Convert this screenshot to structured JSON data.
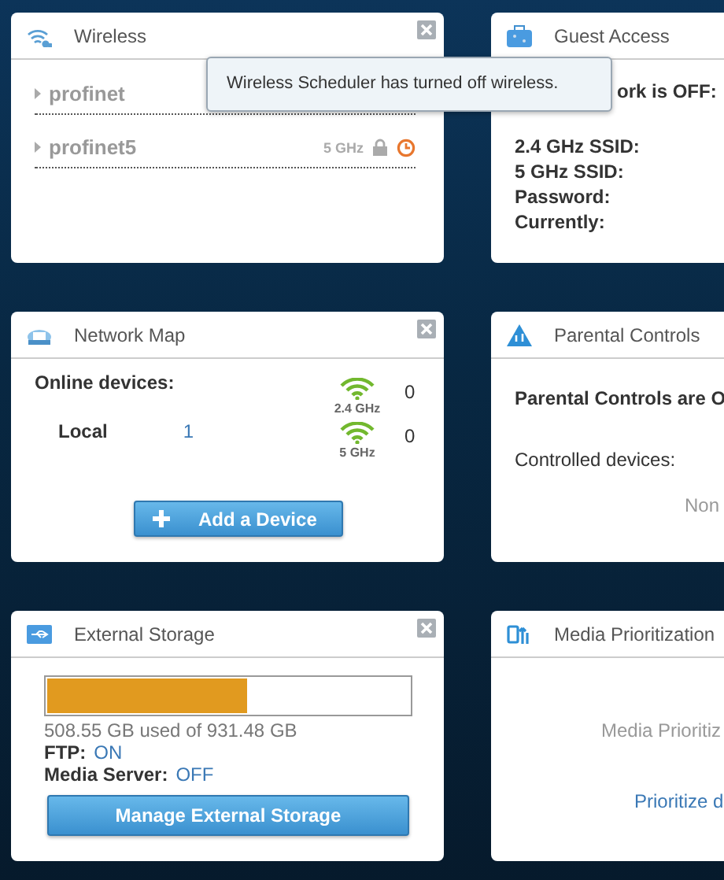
{
  "cards": [
    {
      "kind": "wireless",
      "title": "Wireless",
      "closable": true,
      "networks": [
        {
          "name": "profinet"
        },
        {
          "name": "profinet5",
          "band": "5 GHz",
          "locked": true,
          "scheduled": true
        }
      ],
      "tooltip": "Wireless Scheduler has turned off wireless."
    },
    {
      "kind": "guest",
      "title": "Guest Access",
      "status": "ork is OFF:",
      "fields": [
        "2.4 GHz SSID:",
        "5 GHz SSID:",
        "Password:",
        "Currently:"
      ]
    },
    {
      "kind": "network_map",
      "title": "Network Map",
      "closable": true,
      "heading": "Online devices:",
      "local_label": "Local",
      "local_count": "1",
      "bands": [
        {
          "label": "2.4 GHz",
          "count": "0"
        },
        {
          "label": "5 GHz",
          "count": "0"
        }
      ],
      "button": "Add a Device"
    },
    {
      "kind": "parental",
      "title": "Parental Controls",
      "status": "Parental Controls are O",
      "devices_label": "Controlled devices:",
      "devices_value": "Non"
    },
    {
      "kind": "storage",
      "title": "External Storage",
      "closable": true,
      "level": 0.546,
      "usage": "508.55 GB used of 931.48 GB",
      "settings": [
        {
          "label": "FTP:",
          "value": "ON"
        },
        {
          "label": "Media Server:",
          "value": "OFF"
        }
      ],
      "button": "Manage External Storage"
    },
    {
      "kind": "media",
      "title": "Media Prioritization",
      "message": "Media Prioritiz",
      "link": "Prioritize d"
    }
  ]
}
